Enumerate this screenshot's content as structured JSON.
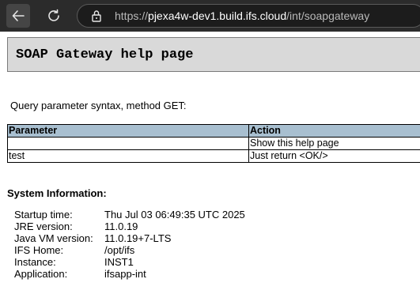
{
  "browser": {
    "url_scheme": "https://",
    "url_host": "pjexa4w-dev1.build.ifs.cloud",
    "url_path": "/int/soapgateway"
  },
  "page": {
    "title": "SOAP Gateway help page",
    "syntax_text": "Query parameter syntax, method GET:"
  },
  "params_table": {
    "headers": [
      "Parameter",
      "Action"
    ],
    "rows": [
      {
        "parameter": "",
        "action": "Show this help page"
      },
      {
        "parameter": "test",
        "action": "Just return <OK/>"
      }
    ]
  },
  "system_info": {
    "title": "System Information:",
    "items": [
      {
        "label": "Startup time:",
        "value": "Thu Jul 03 06:49:35 UTC 2025"
      },
      {
        "label": "JRE version:",
        "value": "11.0.19"
      },
      {
        "label": "Java VM version:",
        "value": "11.0.19+7-LTS"
      },
      {
        "label": "IFS Home:",
        "value": "/opt/ifs"
      },
      {
        "label": "Instance:",
        "value": "INST1"
      },
      {
        "label": "Application:",
        "value": "ifsapp-int"
      }
    ]
  },
  "icons": {
    "back": "arrow-left-icon",
    "reload": "reload-icon",
    "lock": "lock-icon"
  }
}
